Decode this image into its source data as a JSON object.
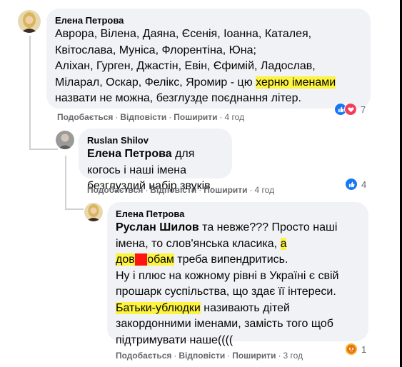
{
  "comments": [
    {
      "author": "Елена Петрова",
      "lines": [
        "Аврора, Вілена, Даяна, Єсенія, Іоанна, Каталея,",
        "Квітослава, Муніса, Флорентіна, Юна;",
        "Аліхан, Гурген, Джастін, Евін, Єфимій, Ладослав,",
        "Міларал, Оскар, Фелікс, Яромир - цю ",
        "херню іменами",
        "назвати не можна, безглузде поєднання літер."
      ],
      "actions": {
        "like": "Подобається",
        "reply": "Відповісти",
        "share": "Поширити",
        "time": "4 год"
      },
      "reaction_count": "7"
    },
    {
      "author": "Ruslan Shilov",
      "mention": "Елена Петрова",
      "lines": [
        " для когось і наші імена",
        "безглуздий набір звуків."
      ],
      "actions": {
        "like": "Подобається",
        "reply": "Відповісти",
        "share": "Поширити",
        "time": "4 год"
      },
      "reaction_count": "4"
    },
    {
      "author": "Елена Петрова",
      "mention": "Руслан Шилов",
      "lines": [
        " та невже??? Просто наші",
        "імена, то слов'янська класика, ",
        "а",
        "дов",
        "ба",
        "обам",
        " треба випендритись.",
        "Ну і плюс на кожному рівні в Україні є свій",
        "прошарк суспільства, що здає її інтереси.",
        "Батьки-ублюдки",
        " називають дітей",
        "закордонними іменами, замість того щоб",
        "підтримувати наше(((("
      ],
      "actions": {
        "like": "Подобається",
        "reply": "Відповісти",
        "share": "Поширити",
        "time": "3 год"
      },
      "reaction_count": "1"
    }
  ],
  "watermark": {
    "main": "0352",
    "sub": "ua"
  },
  "icons": {
    "like": "thumbs-up-icon",
    "love": "heart-icon",
    "angry": "angry-face-icon"
  }
}
